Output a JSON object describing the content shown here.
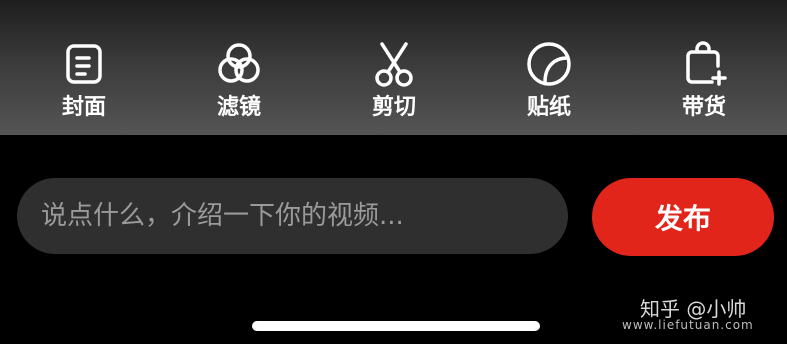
{
  "toolbar": {
    "items": [
      {
        "label": "封面",
        "icon": "cover-icon"
      },
      {
        "label": "滤镜",
        "icon": "filter-icon"
      },
      {
        "label": "剪切",
        "icon": "scissors-icon"
      },
      {
        "label": "贴纸",
        "icon": "sticker-icon"
      },
      {
        "label": "带货",
        "icon": "shopping-bag-add-icon"
      }
    ]
  },
  "composer": {
    "placeholder": "说点什么，介绍一下你的视频...",
    "publish_label": "发布",
    "publish_color": "#e1251b"
  },
  "watermark": {
    "text": "知乎 @小帅",
    "url": "www.liefutuan.com"
  }
}
